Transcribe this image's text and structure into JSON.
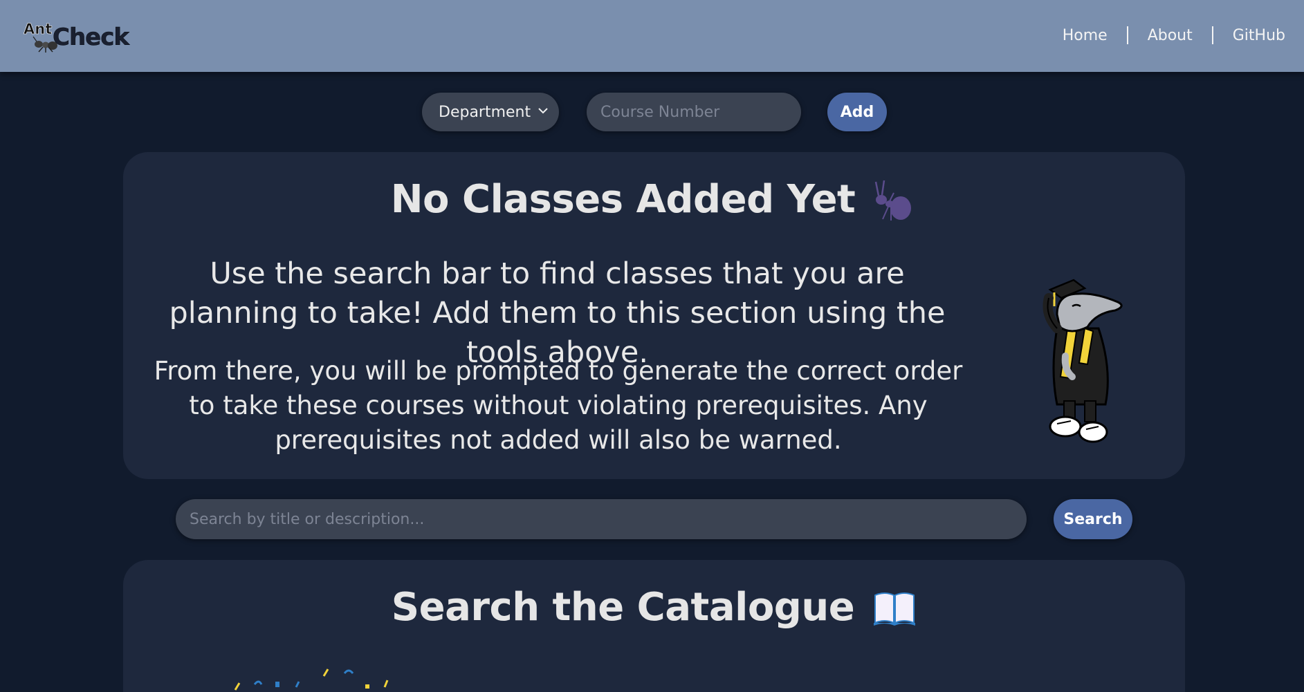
{
  "header": {
    "logo_small": "Ant",
    "logo_big": "Check",
    "nav": [
      {
        "label": "Home"
      },
      {
        "label": "About"
      },
      {
        "label": "GitHub"
      }
    ]
  },
  "add_controls": {
    "department_selected": "Department",
    "course_number_placeholder": "Course Number",
    "add_label": "Add"
  },
  "classes_card": {
    "title": "No Classes Added Yet",
    "title_icon": "ant-icon",
    "lead": "Use the search bar to find classes that you are planning to take! Add them to this section using the tools above.",
    "sub": "From there, you will be prompted to generate the correct order to take these courses without violating prerequisites. Any prerequisites not added will also be warned.",
    "illustration": "graduate-anteater-mascot"
  },
  "search": {
    "placeholder": "Search by title or description...",
    "button_label": "Search"
  },
  "catalogue_card": {
    "title": "Search the Catalogue",
    "title_icon": "open-book-icon",
    "illustration": "confetti"
  },
  "colors": {
    "background": "#111b2d",
    "header": "#7a8fae",
    "card": "#1e283d",
    "input": "#3b4352",
    "button": "#4a67a3",
    "text": "#e6e6e6"
  }
}
